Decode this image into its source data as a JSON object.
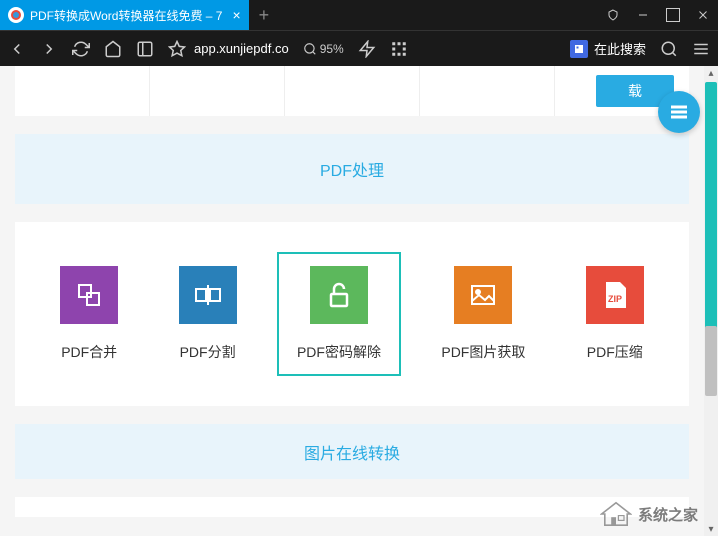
{
  "browser": {
    "tab_title": "PDF转换成Word转换器在线免费 – 7",
    "url_display": "app.xunjiepdf.co",
    "zoom": "95%",
    "search_placeholder": "在此搜索"
  },
  "page": {
    "download_button": "载",
    "sections": {
      "pdf_processing": "PDF处理",
      "image_conversion": "图片在线转换"
    },
    "tools": [
      {
        "id": "merge",
        "label": "PDF合并",
        "color": "purple"
      },
      {
        "id": "split",
        "label": "PDF分割",
        "color": "blue"
      },
      {
        "id": "unlock",
        "label": "PDF密码解除",
        "color": "green",
        "selected": true
      },
      {
        "id": "extract-image",
        "label": "PDF图片获取",
        "color": "orange"
      },
      {
        "id": "compress",
        "label": "PDF压缩",
        "color": "red"
      }
    ]
  },
  "watermark": "系统之家"
}
